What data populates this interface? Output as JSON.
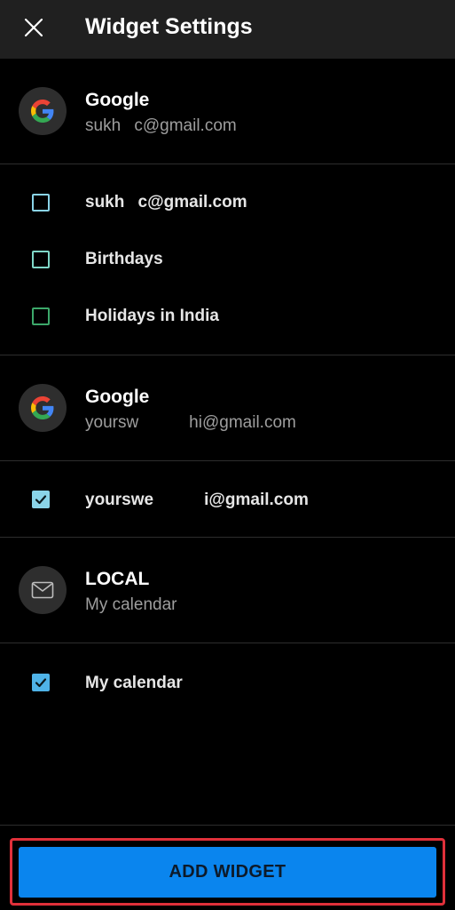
{
  "header": {
    "title": "Widget Settings",
    "close_icon": "close-icon"
  },
  "accounts": [
    {
      "name": "Google",
      "email": "sukh    c@gmail.com",
      "icon": "google-icon",
      "calendars": [
        {
          "label": "sukh    c@gmail.com",
          "checked": false,
          "color": "#8ad4e8"
        },
        {
          "label": "Birthdays",
          "checked": false,
          "color": "#7fd8c8"
        },
        {
          "label": "Holidays in India",
          "checked": false,
          "color": "#3ca86a"
        }
      ]
    },
    {
      "name": "Google",
      "email": "yoursw   hi@gmail.com",
      "icon": "google-icon",
      "calendars": [
        {
          "label": "yourswe   i@gmail.com",
          "checked": true,
          "color": "#8ad4e8"
        }
      ]
    },
    {
      "name": "LOCAL",
      "email": "My calendar",
      "icon": "mail-icon",
      "calendars": [
        {
          "label": "My calendar",
          "checked": true,
          "color": "#4fb3e8"
        }
      ]
    }
  ],
  "footer": {
    "add_widget_label": "ADD WIDGET",
    "button_color": "#0a85ee",
    "highlight_color": "#e0303a"
  }
}
